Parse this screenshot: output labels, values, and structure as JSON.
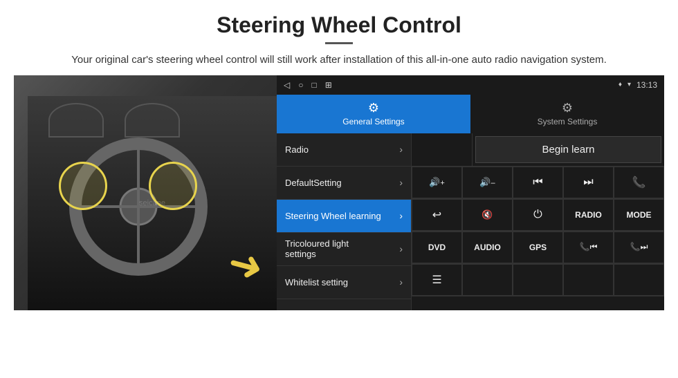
{
  "header": {
    "title": "Steering Wheel Control",
    "subtitle": "Your original car's steering wheel control will still work after installation of this all-in-one auto radio navigation system."
  },
  "status_bar": {
    "time": "13:13",
    "icons": [
      "◁",
      "○",
      "□",
      "⊞"
    ]
  },
  "tabs": [
    {
      "id": "general",
      "label": "General Settings",
      "active": true,
      "icon": "⚙"
    },
    {
      "id": "system",
      "label": "System Settings",
      "active": false,
      "icon": "⚙"
    }
  ],
  "menu_items": [
    {
      "label": "Radio",
      "active": false
    },
    {
      "label": "DefaultSetting",
      "active": false
    },
    {
      "label": "Steering Wheel learning",
      "active": true
    },
    {
      "label": "Tricoloured light settings",
      "active": false
    },
    {
      "label": "Whitelist setting",
      "active": false
    }
  ],
  "begin_learn_label": "Begin learn",
  "control_buttons_row1": [
    {
      "icon": "🔊+",
      "label": "vol up"
    },
    {
      "icon": "🔊-",
      "label": "vol down"
    },
    {
      "icon": "⏮",
      "label": "prev"
    },
    {
      "icon": "⏭",
      "label": "next"
    },
    {
      "icon": "📞",
      "label": "call"
    }
  ],
  "control_buttons_row2": [
    {
      "icon": "↩",
      "label": "hang up"
    },
    {
      "icon": "🔇",
      "label": "mute"
    },
    {
      "icon": "⏻",
      "label": "power"
    },
    {
      "text": "RADIO",
      "label": "radio"
    },
    {
      "text": "MODE",
      "label": "mode"
    }
  ],
  "control_buttons_row3": [
    {
      "text": "DVD",
      "label": "dvd"
    },
    {
      "text": "AUDIO",
      "label": "audio"
    },
    {
      "text": "GPS",
      "label": "gps"
    },
    {
      "icon": "📞⏮",
      "label": "call prev"
    },
    {
      "icon": "📞⏭",
      "label": "call next"
    }
  ],
  "last_row": [
    {
      "icon": "☰",
      "label": "menu"
    }
  ]
}
